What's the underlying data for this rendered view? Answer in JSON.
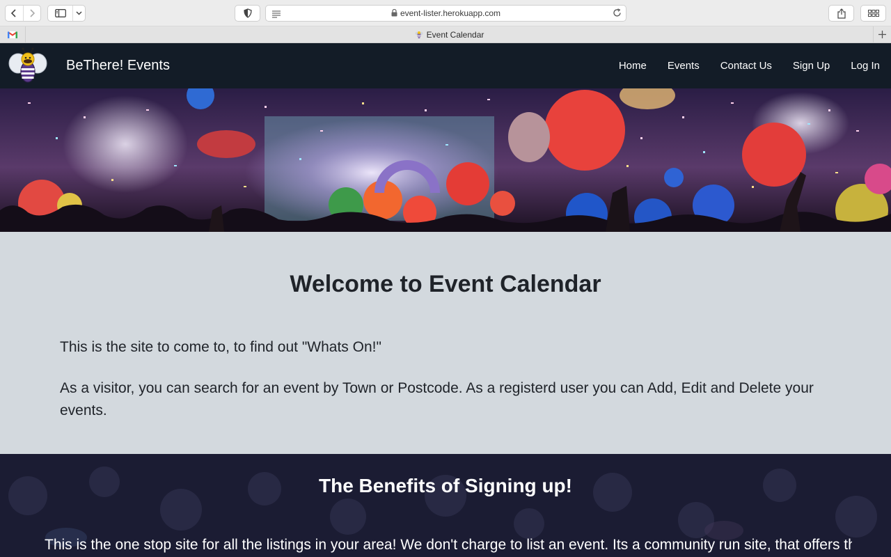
{
  "browser": {
    "url": "event-lister.herokuapp.com",
    "tab_title": "Event Calendar",
    "icons": {
      "back": "chevron-left-icon",
      "forward": "chevron-right-icon",
      "sidebar": "sidebar-icon",
      "privacy": "shield-icon",
      "reader": "reader-icon",
      "lock": "lock-icon",
      "reload": "reload-icon",
      "share": "share-icon",
      "tab_overview": "grid-icon",
      "new_tab": "plus-icon",
      "pinned_tab": "gmail-icon"
    }
  },
  "navbar": {
    "brand": "BeThere! Events",
    "links": [
      "Home",
      "Events",
      "Contact Us",
      "Sign Up",
      "Log In"
    ],
    "background": "#131c27"
  },
  "welcome": {
    "heading": "Welcome to Event Calendar",
    "paragraph1": "This is the site to come to, to find out \"Whats On!\"",
    "paragraph2": "As a visitor, you can search for an event by Town or Postcode. As a registerd user you can Add, Edit and Delete your events.",
    "background": "#d3d9de"
  },
  "benefits": {
    "heading": "The Benefits of Signing up!",
    "paragraph": "This is the one stop site for all the listings in your area! We don't charge to list an event. Its a community run site, that offers this",
    "background": "#1b1c33"
  }
}
